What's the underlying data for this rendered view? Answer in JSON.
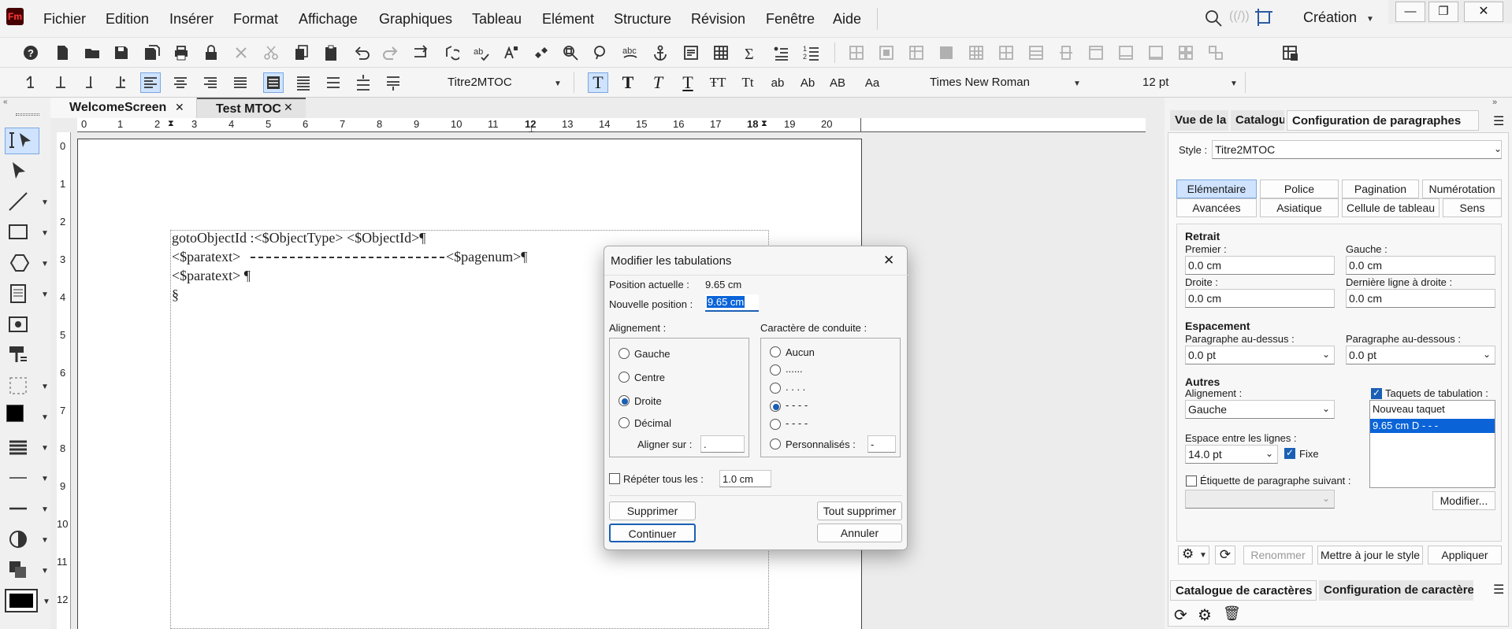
{
  "app": {
    "logo": "Fm",
    "workspace": "Création"
  },
  "menu": [
    "Fichier",
    "Edition",
    "Insérer",
    "Format",
    "Affichage",
    "Graphiques",
    "Tableau",
    "Elément",
    "Structure",
    "Révision",
    "Fenêtre",
    "Aide"
  ],
  "window_controls": {
    "minimize": "—",
    "restore": "❐",
    "close": "✕"
  },
  "toolbar2": {
    "para_style": "Titre2MTOC",
    "font": "Times New Roman",
    "size": "12 pt",
    "char_buttons": [
      "T",
      "T",
      "T",
      "T",
      "ŦT",
      "Tt",
      "ab",
      "Ab",
      "AB",
      "Aa"
    ]
  },
  "tabs": [
    {
      "label": "WelcomeScreen",
      "close": "✕"
    },
    {
      "label": "Test MTOC",
      "close": "✕"
    }
  ],
  "ruler": [
    "0",
    "1",
    "2",
    "3",
    "4",
    "5",
    "6",
    "7",
    "8",
    "9",
    "10",
    "11",
    "12",
    "13",
    "14",
    "15",
    "16",
    "17",
    "18",
    "19",
    "20"
  ],
  "vruler": [
    "0",
    "1",
    "2",
    "3",
    "4",
    "5",
    "6",
    "7",
    "8",
    "9",
    "10",
    "11",
    "12"
  ],
  "document": {
    "lines": [
      "gotoObjectId :<$ObjectType> <$ObjectId>¶",
      "<$paratext>",
      "<$pagenum>¶",
      "<$paratext> ¶",
      "§"
    ]
  },
  "dialog": {
    "title": "Modifier les tabulations",
    "close": "✕",
    "current_label": "Position actuelle :",
    "current_value": "9.65 cm",
    "new_label": "Nouvelle position :",
    "new_value": "9.65 cm",
    "alignment_label": "Alignement :",
    "alignment_options": [
      "Gauche",
      "Centre",
      "Droite",
      "Décimal"
    ],
    "alignment_selected": "Droite",
    "align_on_label": "Aligner sur :",
    "align_on_value": ".",
    "leader_label": "Caractère de conduite :",
    "leader_options": [
      "Aucun",
      "......",
      ". . . .",
      "- - - -",
      "- - - -",
      "Personnalisés :"
    ],
    "leader_selected_index": 3,
    "custom_value": "-",
    "repeat_label": "Répéter tous les :",
    "repeat_value": "1.0 cm",
    "repeat_checked": false,
    "delete": "Supprimer",
    "delete_all": "Tout supprimer",
    "continue": "Continuer",
    "cancel": "Annuler"
  },
  "panel": {
    "tabs": [
      "Vue de la",
      "Catalogu",
      "Configuration de paragraphes"
    ],
    "style_label": "Style :",
    "style_value": "Titre2MTOC",
    "subtabs_row1": [
      "Elémentaire",
      "Police",
      "Pagination",
      "Numérotation"
    ],
    "subtabs_row2": [
      "Avancées",
      "Asiatique",
      "Cellule de tableau",
      "Sens"
    ],
    "retrait": "Retrait",
    "premier_label": "Premier :",
    "premier_value": "0.0 cm",
    "gauche_label": "Gauche :",
    "gauche_value": "0.0 cm",
    "droite_label": "Droite :",
    "droite_value": "0.0 cm",
    "derniere_label": "Dernière ligne à droite :",
    "derniere_value": "0.0 cm",
    "espacement": "Espacement",
    "dessus_label": "Paragraphe au-dessus :",
    "dessus_value": "0.0 pt",
    "dessous_label": "Paragraphe au-dessous :",
    "dessous_value": "0.0 pt",
    "autres": "Autres",
    "align_label": "Alignement :",
    "align_value": "Gauche",
    "taquets_label": "Taquets de tabulation :",
    "taquets_items": [
      "Nouveau taquet",
      "9.65 cm  D  - - -"
    ],
    "espace_label": "Espace entre les lignes :",
    "espace_value": "14.0 pt",
    "fixe_label": "Fixe",
    "etiquette_label": "Étiquette de paragraphe suivant :",
    "modifier": "Modifier...",
    "renommer": "Renommer",
    "mettre": "Mettre à jour le style",
    "appliquer": "Appliquer",
    "bottom_tabs": [
      "Catalogue de caractères",
      "Configuration de caractère"
    ]
  },
  "colors": {
    "accent": "#1a5fb4",
    "selection": "#0a64d8",
    "tab_active": "#cfe3ff"
  }
}
